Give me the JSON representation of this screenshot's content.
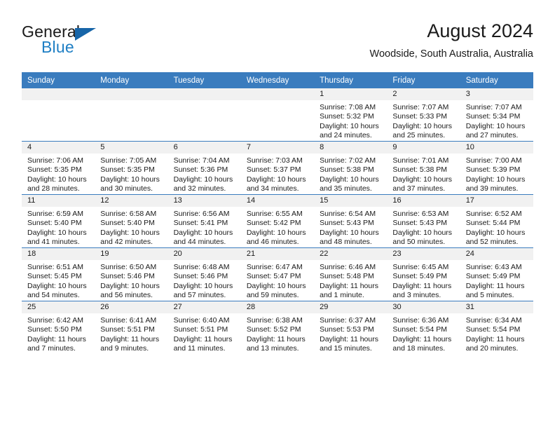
{
  "brand": {
    "name_part1": "General",
    "name_part2": "Blue",
    "logo_icon": "triangle-logo-icon"
  },
  "header": {
    "title": "August 2024",
    "subtitle": "Woodside, South Australia, Australia"
  },
  "colors": {
    "header_blue": "#3a7cbe",
    "brand_blue": "#1f7fc4",
    "daynum_band": "#f1f1f1",
    "text": "#1a1a1a"
  },
  "calendar": {
    "weekday_headers": [
      "Sunday",
      "Monday",
      "Tuesday",
      "Wednesday",
      "Thursday",
      "Friday",
      "Saturday"
    ],
    "weeks": [
      [
        {
          "day": "",
          "lines": []
        },
        {
          "day": "",
          "lines": []
        },
        {
          "day": "",
          "lines": []
        },
        {
          "day": "",
          "lines": []
        },
        {
          "day": "1",
          "lines": [
            "Sunrise: 7:08 AM",
            "Sunset: 5:32 PM",
            "Daylight: 10 hours",
            "and 24 minutes."
          ]
        },
        {
          "day": "2",
          "lines": [
            "Sunrise: 7:07 AM",
            "Sunset: 5:33 PM",
            "Daylight: 10 hours",
            "and 25 minutes."
          ]
        },
        {
          "day": "3",
          "lines": [
            "Sunrise: 7:07 AM",
            "Sunset: 5:34 PM",
            "Daylight: 10 hours",
            "and 27 minutes."
          ]
        }
      ],
      [
        {
          "day": "4",
          "lines": [
            "Sunrise: 7:06 AM",
            "Sunset: 5:35 PM",
            "Daylight: 10 hours",
            "and 28 minutes."
          ]
        },
        {
          "day": "5",
          "lines": [
            "Sunrise: 7:05 AM",
            "Sunset: 5:35 PM",
            "Daylight: 10 hours",
            "and 30 minutes."
          ]
        },
        {
          "day": "6",
          "lines": [
            "Sunrise: 7:04 AM",
            "Sunset: 5:36 PM",
            "Daylight: 10 hours",
            "and 32 minutes."
          ]
        },
        {
          "day": "7",
          "lines": [
            "Sunrise: 7:03 AM",
            "Sunset: 5:37 PM",
            "Daylight: 10 hours",
            "and 34 minutes."
          ]
        },
        {
          "day": "8",
          "lines": [
            "Sunrise: 7:02 AM",
            "Sunset: 5:38 PM",
            "Daylight: 10 hours",
            "and 35 minutes."
          ]
        },
        {
          "day": "9",
          "lines": [
            "Sunrise: 7:01 AM",
            "Sunset: 5:38 PM",
            "Daylight: 10 hours",
            "and 37 minutes."
          ]
        },
        {
          "day": "10",
          "lines": [
            "Sunrise: 7:00 AM",
            "Sunset: 5:39 PM",
            "Daylight: 10 hours",
            "and 39 minutes."
          ]
        }
      ],
      [
        {
          "day": "11",
          "lines": [
            "Sunrise: 6:59 AM",
            "Sunset: 5:40 PM",
            "Daylight: 10 hours",
            "and 41 minutes."
          ]
        },
        {
          "day": "12",
          "lines": [
            "Sunrise: 6:58 AM",
            "Sunset: 5:40 PM",
            "Daylight: 10 hours",
            "and 42 minutes."
          ]
        },
        {
          "day": "13",
          "lines": [
            "Sunrise: 6:56 AM",
            "Sunset: 5:41 PM",
            "Daylight: 10 hours",
            "and 44 minutes."
          ]
        },
        {
          "day": "14",
          "lines": [
            "Sunrise: 6:55 AM",
            "Sunset: 5:42 PM",
            "Daylight: 10 hours",
            "and 46 minutes."
          ]
        },
        {
          "day": "15",
          "lines": [
            "Sunrise: 6:54 AM",
            "Sunset: 5:43 PM",
            "Daylight: 10 hours",
            "and 48 minutes."
          ]
        },
        {
          "day": "16",
          "lines": [
            "Sunrise: 6:53 AM",
            "Sunset: 5:43 PM",
            "Daylight: 10 hours",
            "and 50 minutes."
          ]
        },
        {
          "day": "17",
          "lines": [
            "Sunrise: 6:52 AM",
            "Sunset: 5:44 PM",
            "Daylight: 10 hours",
            "and 52 minutes."
          ]
        }
      ],
      [
        {
          "day": "18",
          "lines": [
            "Sunrise: 6:51 AM",
            "Sunset: 5:45 PM",
            "Daylight: 10 hours",
            "and 54 minutes."
          ]
        },
        {
          "day": "19",
          "lines": [
            "Sunrise: 6:50 AM",
            "Sunset: 5:46 PM",
            "Daylight: 10 hours",
            "and 56 minutes."
          ]
        },
        {
          "day": "20",
          "lines": [
            "Sunrise: 6:48 AM",
            "Sunset: 5:46 PM",
            "Daylight: 10 hours",
            "and 57 minutes."
          ]
        },
        {
          "day": "21",
          "lines": [
            "Sunrise: 6:47 AM",
            "Sunset: 5:47 PM",
            "Daylight: 10 hours",
            "and 59 minutes."
          ]
        },
        {
          "day": "22",
          "lines": [
            "Sunrise: 6:46 AM",
            "Sunset: 5:48 PM",
            "Daylight: 11 hours",
            "and 1 minute."
          ]
        },
        {
          "day": "23",
          "lines": [
            "Sunrise: 6:45 AM",
            "Sunset: 5:49 PM",
            "Daylight: 11 hours",
            "and 3 minutes."
          ]
        },
        {
          "day": "24",
          "lines": [
            "Sunrise: 6:43 AM",
            "Sunset: 5:49 PM",
            "Daylight: 11 hours",
            "and 5 minutes."
          ]
        }
      ],
      [
        {
          "day": "25",
          "lines": [
            "Sunrise: 6:42 AM",
            "Sunset: 5:50 PM",
            "Daylight: 11 hours",
            "and 7 minutes."
          ]
        },
        {
          "day": "26",
          "lines": [
            "Sunrise: 6:41 AM",
            "Sunset: 5:51 PM",
            "Daylight: 11 hours",
            "and 9 minutes."
          ]
        },
        {
          "day": "27",
          "lines": [
            "Sunrise: 6:40 AM",
            "Sunset: 5:51 PM",
            "Daylight: 11 hours",
            "and 11 minutes."
          ]
        },
        {
          "day": "28",
          "lines": [
            "Sunrise: 6:38 AM",
            "Sunset: 5:52 PM",
            "Daylight: 11 hours",
            "and 13 minutes."
          ]
        },
        {
          "day": "29",
          "lines": [
            "Sunrise: 6:37 AM",
            "Sunset: 5:53 PM",
            "Daylight: 11 hours",
            "and 15 minutes."
          ]
        },
        {
          "day": "30",
          "lines": [
            "Sunrise: 6:36 AM",
            "Sunset: 5:54 PM",
            "Daylight: 11 hours",
            "and 18 minutes."
          ]
        },
        {
          "day": "31",
          "lines": [
            "Sunrise: 6:34 AM",
            "Sunset: 5:54 PM",
            "Daylight: 11 hours",
            "and 20 minutes."
          ]
        }
      ]
    ]
  }
}
